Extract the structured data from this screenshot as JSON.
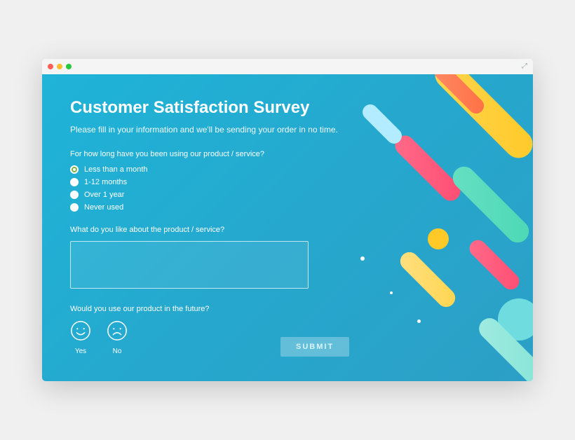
{
  "window": {
    "expand_glyph": "⤢"
  },
  "survey": {
    "title": "Customer Satisfaction Survey",
    "subtitle": "Please fill in your information and we'll be sending your order in no time.",
    "q1": {
      "label": "For how long have you been using our product / service?",
      "options": [
        {
          "label": "Less than a month",
          "selected": true
        },
        {
          "label": "1-12 months",
          "selected": false
        },
        {
          "label": "Over 1 year",
          "selected": false
        },
        {
          "label": "Never used",
          "selected": false
        }
      ]
    },
    "q2": {
      "label": "What do you like about the product / service?",
      "value": ""
    },
    "q3": {
      "label": "Would you use our product in the future?",
      "yes_label": "Yes",
      "no_label": "No"
    },
    "submit_label": "SUBMIT"
  },
  "colors": {
    "accent_green": "#7cb342",
    "gradient_start": "#1fb4d8",
    "gradient_end": "#2c9fc6"
  }
}
